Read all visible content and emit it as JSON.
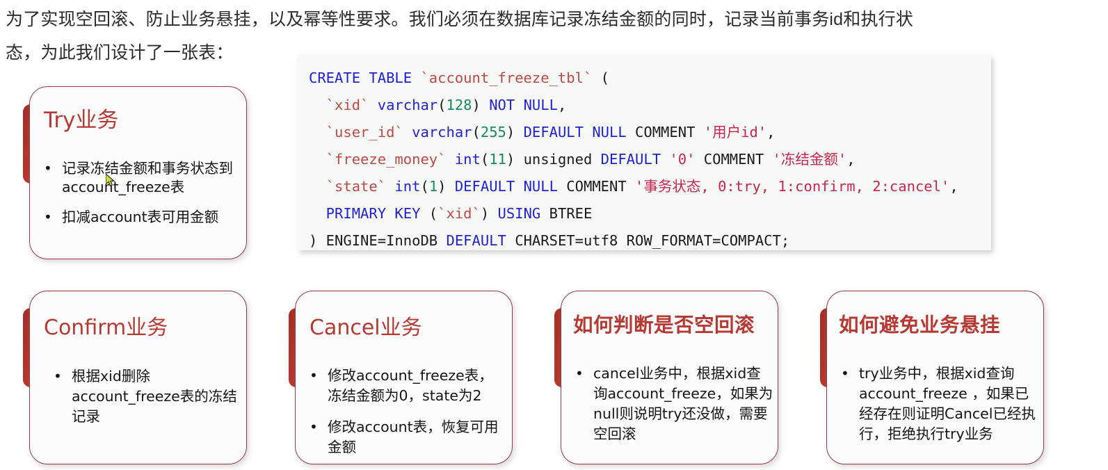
{
  "intro": {
    "paragraph": "为了实现空回滚、防止业务悬挂，以及幂等性要求。我们必须在数据库记录冻结金额的同时，记录当前事务id和执行状\n态，为此我们设计了一张表："
  },
  "code_block": {
    "language": "sql",
    "background_color": "#f7f9f7",
    "colors": {
      "keyword": "#2222cc",
      "identifier": "#b94a48",
      "number": "#1b8a5a",
      "string": "#c7254e",
      "plain": "#1a1a1a"
    },
    "lines": [
      [
        {
          "t": "CREATE TABLE ",
          "c": "tok-kw"
        },
        {
          "t": "`account_freeze_tbl`",
          "c": "tok-ident"
        },
        {
          "t": " (",
          "c": "tok-plain"
        }
      ],
      [
        {
          "t": "  `xid`",
          "c": "tok-ident"
        },
        {
          "t": " varchar",
          "c": "tok-kw"
        },
        {
          "t": "(",
          "c": "tok-plain"
        },
        {
          "t": "128",
          "c": "tok-num"
        },
        {
          "t": ") ",
          "c": "tok-plain"
        },
        {
          "t": "NOT NULL",
          "c": "tok-kw"
        },
        {
          "t": ",",
          "c": "tok-plain"
        }
      ],
      [
        {
          "t": "  `user_id`",
          "c": "tok-ident"
        },
        {
          "t": " varchar",
          "c": "tok-kw"
        },
        {
          "t": "(",
          "c": "tok-plain"
        },
        {
          "t": "255",
          "c": "tok-num"
        },
        {
          "t": ") ",
          "c": "tok-plain"
        },
        {
          "t": "DEFAULT NULL",
          "c": "tok-kw"
        },
        {
          "t": " COMMENT ",
          "c": "tok-plain"
        },
        {
          "t": "'用户id'",
          "c": "tok-str"
        },
        {
          "t": ",",
          "c": "tok-plain"
        }
      ],
      [
        {
          "t": "  `freeze_money`",
          "c": "tok-ident"
        },
        {
          "t": " int",
          "c": "tok-kw"
        },
        {
          "t": "(",
          "c": "tok-plain"
        },
        {
          "t": "11",
          "c": "tok-num"
        },
        {
          "t": ") unsigned ",
          "c": "tok-plain"
        },
        {
          "t": "DEFAULT",
          "c": "tok-kw"
        },
        {
          "t": " ",
          "c": "tok-plain"
        },
        {
          "t": "'0'",
          "c": "tok-str"
        },
        {
          "t": " COMMENT ",
          "c": "tok-plain"
        },
        {
          "t": "'冻结金额'",
          "c": "tok-str"
        },
        {
          "t": ",",
          "c": "tok-plain"
        }
      ],
      [
        {
          "t": "  `state`",
          "c": "tok-ident"
        },
        {
          "t": " int",
          "c": "tok-kw"
        },
        {
          "t": "(",
          "c": "tok-plain"
        },
        {
          "t": "1",
          "c": "tok-num"
        },
        {
          "t": ") ",
          "c": "tok-plain"
        },
        {
          "t": "DEFAULT NULL",
          "c": "tok-kw"
        },
        {
          "t": " COMMENT ",
          "c": "tok-plain"
        },
        {
          "t": "'事务状态, 0:try, 1:confirm, 2:cancel'",
          "c": "tok-str"
        },
        {
          "t": ",",
          "c": "tok-plain"
        }
      ],
      [
        {
          "t": "  PRIMARY KEY ",
          "c": "tok-kw"
        },
        {
          "t": "(",
          "c": "tok-plain"
        },
        {
          "t": "`xid`",
          "c": "tok-ident"
        },
        {
          "t": ") ",
          "c": "tok-plain"
        },
        {
          "t": "USING",
          "c": "tok-kw"
        },
        {
          "t": " BTREE",
          "c": "tok-plain"
        }
      ],
      [
        {
          "t": ") ENGINE=InnoDB ",
          "c": "tok-plain"
        },
        {
          "t": "DEFAULT",
          "c": "tok-kw"
        },
        {
          "t": " CHARSET=utf8 ROW_FORMAT=COMPACT;",
          "c": "tok-plain"
        }
      ]
    ]
  },
  "cards": {
    "try": {
      "title": "Try业务",
      "bullets": [
        "记录冻结金额和事务状态到account_freeze表",
        "扣减account表可用金额"
      ]
    },
    "confirm": {
      "title": "Confirm业务",
      "bullets": [
        "根据xid删除account_freeze表的冻结记录"
      ]
    },
    "cancel": {
      "title": "Cancel业务",
      "bullets": [
        "修改account_freeze表，冻结金额为0，state为2",
        "修改account表，恢复可用金额"
      ]
    },
    "empty_rollback": {
      "title": "如何判断是否空回滚",
      "bullets": [
        "cancel业务中，根据xid查询account_freeze，如果为null则说明try还没做，需要空回滚"
      ]
    },
    "avoid_hang": {
      "title": "如何避免业务悬挂",
      "bullets": [
        "try业务中，根据xid查询account_freeze ，如果已经存在则证明Cancel已经执行，拒绝执行try业务"
      ]
    }
  },
  "theme": {
    "card_border_color": "#8e3a47",
    "card_tab_color": "#b3352b",
    "title_color": "#b43a33",
    "text_color": "#141414"
  }
}
